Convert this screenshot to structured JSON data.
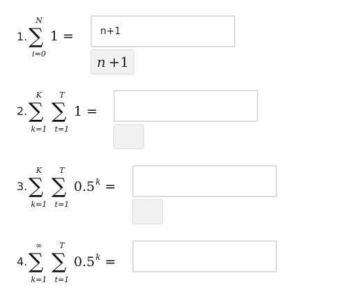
{
  "questions": [
    {
      "number": "1.",
      "sums": [
        {
          "upper": "N",
          "lower": "i=0"
        }
      ],
      "term": "1",
      "term_exponent": "",
      "equals": "=",
      "answer_value": "n+1",
      "preview": {
        "var": "n",
        "rest": "+1"
      }
    },
    {
      "number": "2.",
      "sums": [
        {
          "upper": "K",
          "lower": "k=1"
        },
        {
          "upper": "T",
          "lower": "t=1"
        }
      ],
      "term": "1",
      "term_exponent": "",
      "equals": "=",
      "answer_value": "",
      "preview": {
        "var": "",
        "rest": ""
      }
    },
    {
      "number": "3.",
      "sums": [
        {
          "upper": "K",
          "lower": "k=1"
        },
        {
          "upper": "T",
          "lower": "t=1"
        }
      ],
      "term": "0.5",
      "term_exponent": "k",
      "equals": "=",
      "answer_value": "",
      "preview": {
        "var": "",
        "rest": ""
      }
    },
    {
      "number": "4.",
      "sums": [
        {
          "upper": "∞",
          "lower": "k=1"
        },
        {
          "upper": "T",
          "lower": "t=1"
        }
      ],
      "term": "0.5",
      "term_exponent": "k",
      "equals": "=",
      "answer_value": ""
    }
  ],
  "sigma_symbol": "∑"
}
